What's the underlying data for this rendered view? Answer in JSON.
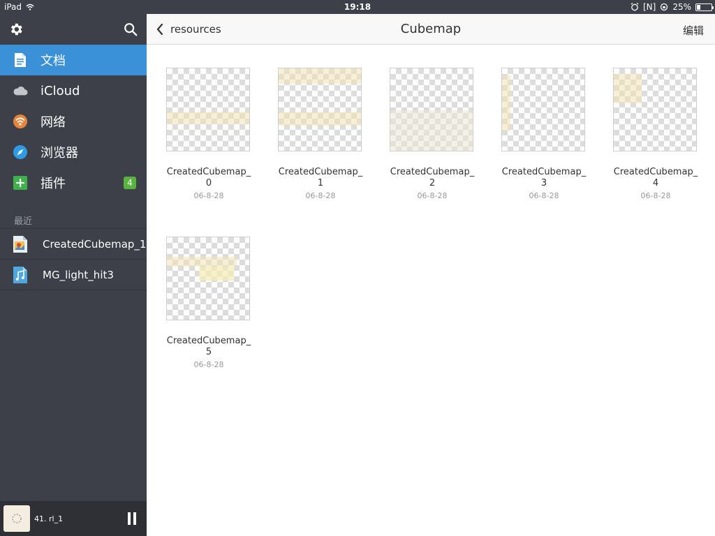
{
  "status_bar": {
    "device": "iPad",
    "time": "19:18",
    "indicator_n": "[N]",
    "battery": "25%",
    "battery_level": 0.25
  },
  "sidebar": {
    "nav": [
      {
        "label": "文档",
        "icon": "document-icon",
        "active": true
      },
      {
        "label": "iCloud",
        "icon": "cloud-icon",
        "active": false
      },
      {
        "label": "网络",
        "icon": "wifi-icon",
        "active": false
      },
      {
        "label": "浏览器",
        "icon": "compass-icon",
        "active": false
      },
      {
        "label": "插件",
        "icon": "plugin-icon",
        "active": false,
        "badge": "4"
      }
    ],
    "recent_label": "最近",
    "recent": [
      {
        "label": "CreatedCubemap_1",
        "icon": "image-file-icon"
      },
      {
        "label": "MG_light_hit3",
        "icon": "music-file-icon"
      }
    ],
    "player": {
      "track": "41. rl_1"
    }
  },
  "main": {
    "back_label": "resources",
    "title": "Cubemap",
    "edit_label": "编辑",
    "files": [
      {
        "name": "CreatedCubemap_0",
        "date": "06-8-28"
      },
      {
        "name": "CreatedCubemap_1",
        "date": "06-8-28"
      },
      {
        "name": "CreatedCubemap_2",
        "date": "06-8-28"
      },
      {
        "name": "CreatedCubemap_3",
        "date": "06-8-28"
      },
      {
        "name": "CreatedCubemap_4",
        "date": "06-8-28"
      },
      {
        "name": "CreatedCubemap_5",
        "date": "06-8-28"
      }
    ]
  },
  "colors": {
    "sidebar_bg": "#3d4048",
    "active_blue": "#3a91d8",
    "badge_green": "#58b33f"
  }
}
